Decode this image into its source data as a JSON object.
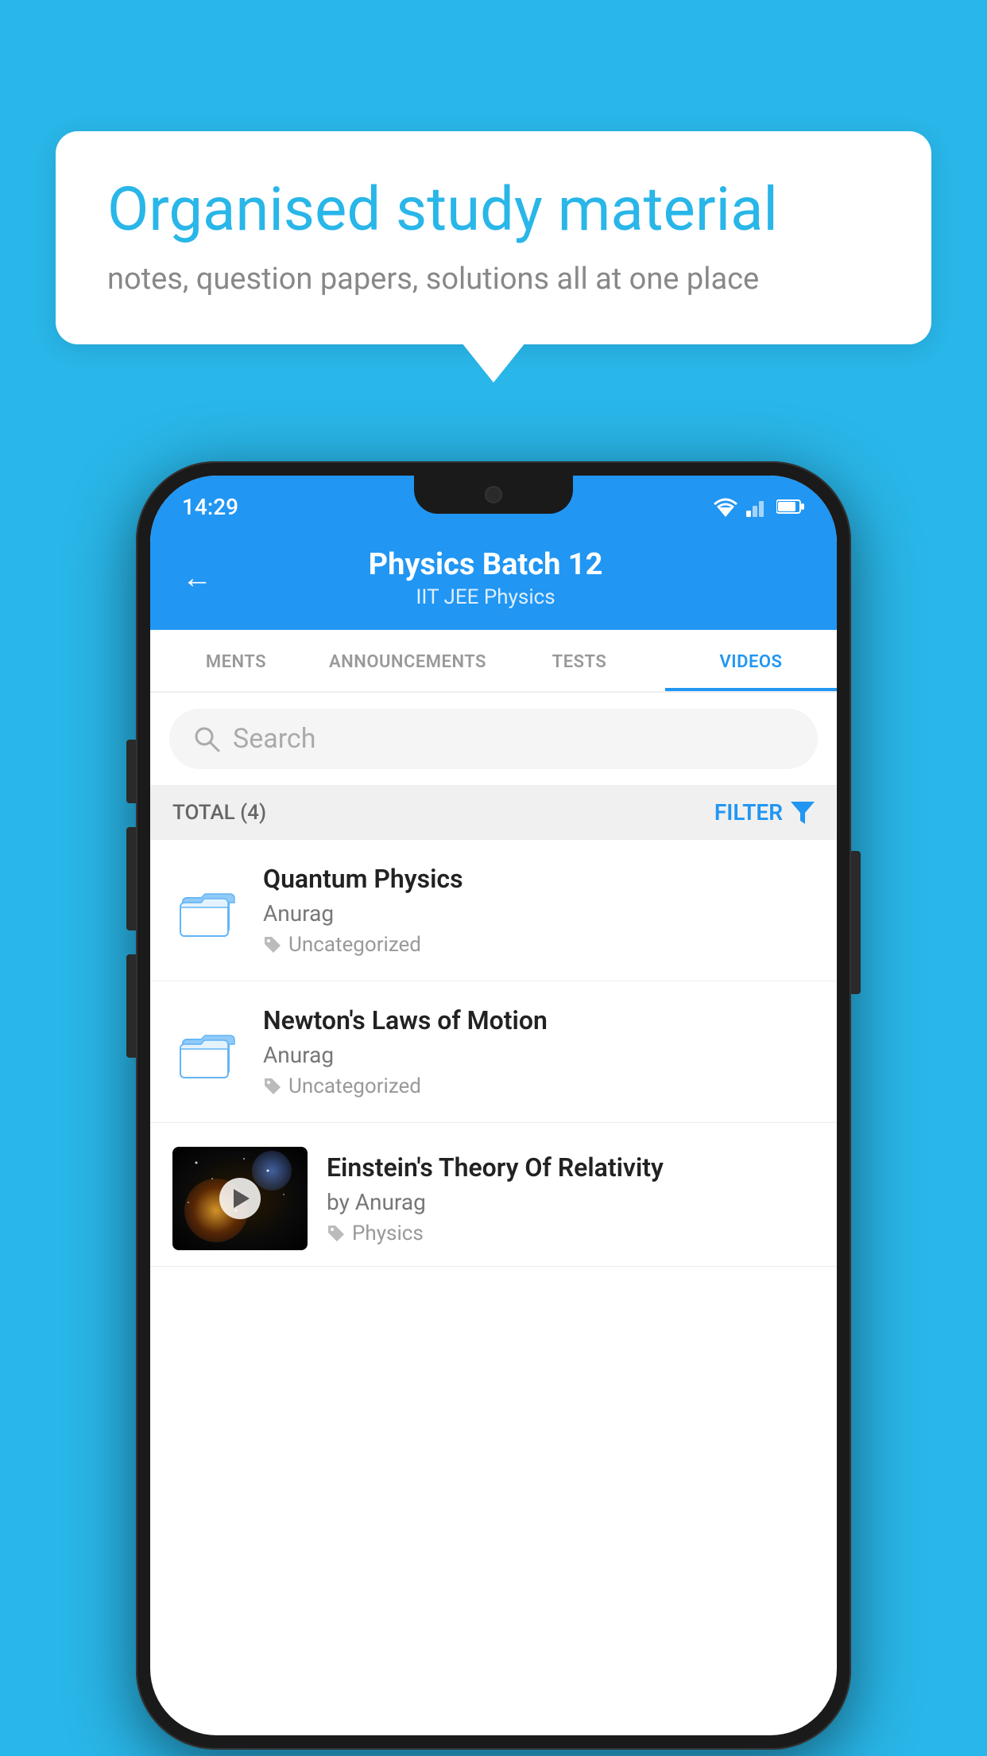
{
  "bubble": {
    "title": "Organised study material",
    "subtitle": "notes, question papers, solutions all at one place"
  },
  "statusBar": {
    "time": "14:29",
    "wifi": "▼",
    "signal": "◀",
    "battery": "▐"
  },
  "header": {
    "title": "Physics Batch 12",
    "subtitle": "IIT JEE   Physics",
    "backLabel": "←"
  },
  "tabs": [
    {
      "label": "MENTS",
      "active": false
    },
    {
      "label": "ANNOUNCEMENTS",
      "active": false
    },
    {
      "label": "TESTS",
      "active": false
    },
    {
      "label": "VIDEOS",
      "active": true
    }
  ],
  "search": {
    "placeholder": "Search"
  },
  "filterBar": {
    "totalLabel": "TOTAL (4)",
    "filterLabel": "FILTER"
  },
  "videos": [
    {
      "title": "Quantum Physics",
      "author": "Anurag",
      "tag": "Uncategorized",
      "hasThumb": false
    },
    {
      "title": "Newton's Laws of Motion",
      "author": "Anurag",
      "tag": "Uncategorized",
      "hasThumb": false
    },
    {
      "title": "Einstein's Theory Of Relativity",
      "author": "by Anurag",
      "tag": "Physics",
      "hasThumb": true
    }
  ]
}
